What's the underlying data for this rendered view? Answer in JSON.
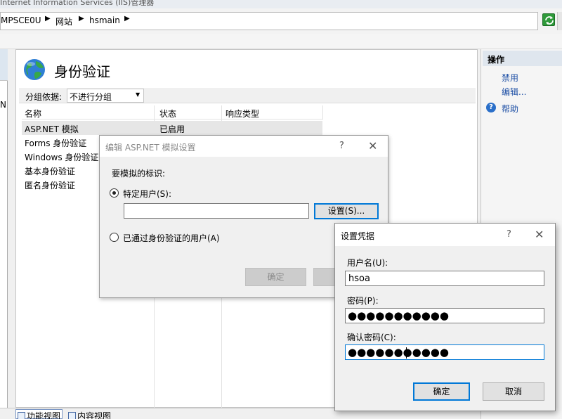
{
  "window": {
    "title": "Internet Information Services (IIS)管理器"
  },
  "breadcrumb": [
    {
      "label": "MPSCE0U"
    },
    {
      "label": "网站"
    },
    {
      "label": "hsmain"
    }
  ],
  "page": {
    "title": "身份验证",
    "group_by_label": "分组依据:",
    "group_by_value": "不进行分组",
    "columns": [
      "名称",
      "状态",
      "响应类型"
    ],
    "rows": [
      {
        "name": "ASP.NET 模拟",
        "status": "已启用",
        "response": ""
      },
      {
        "name": "Forms 身份验证",
        "status": "",
        "response": ""
      },
      {
        "name": "Windows 身份验证",
        "status": "",
        "response": ""
      },
      {
        "name": "基本身份验证",
        "status": "",
        "response": ""
      },
      {
        "name": "匿名身份验证",
        "status": "",
        "response": ""
      }
    ]
  },
  "left_panel": {
    "partial_text": "N"
  },
  "actions": {
    "title": "操作",
    "items": [
      "禁用",
      "编辑..."
    ],
    "help": "帮助"
  },
  "bottom_tabs": [
    "功能视图",
    "内容视图"
  ],
  "dialog_impersonation": {
    "title": "编辑 ASP.NET 模拟设置",
    "help_glyph": "?",
    "section_label": "要模拟的标识:",
    "option_specific": "特定用户(S):",
    "set_button": "设置(S)...",
    "option_authenticated": "已通过身份验证的用户(A)",
    "ok_button": "确定"
  },
  "dialog_credentials": {
    "title": "设置凭据",
    "help_glyph": "?",
    "username_label": "用户名(U):",
    "username_value": "hsoa",
    "password_label": "密码(P):",
    "password_value": "●●●●●●●●●●●",
    "confirm_label": "确认密码(C):",
    "confirm_value": "●●●●●●●●●●●",
    "ok_button": "确定",
    "cancel_button": "取消"
  },
  "colors": {
    "accent": "#0078d7",
    "link": "#1d4fa5",
    "selected_row": "#e6e6e6"
  }
}
